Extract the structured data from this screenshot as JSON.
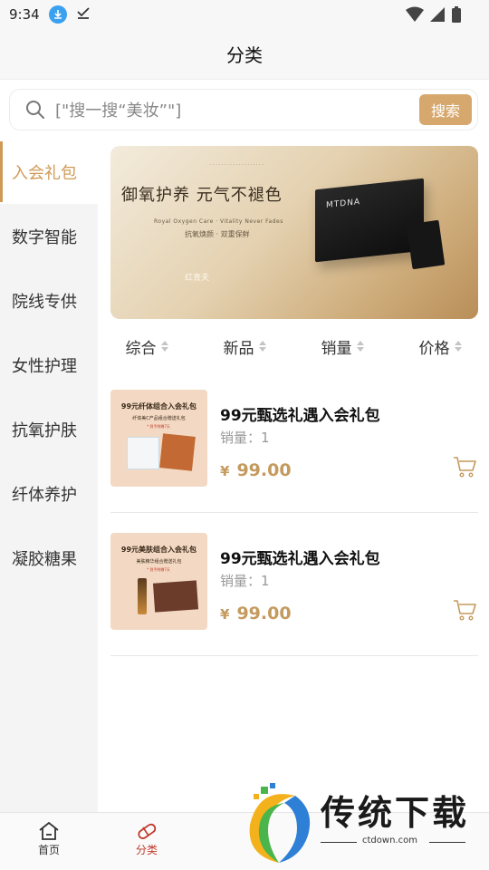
{
  "status": {
    "time": "9:34"
  },
  "title": "分类",
  "search": {
    "placeholder": "[\"搜一搜“美妆”\"]",
    "button": "搜索"
  },
  "sidebar": {
    "items": [
      {
        "label": "入会礼包",
        "active": true
      },
      {
        "label": "数字智能"
      },
      {
        "label": "院线专供"
      },
      {
        "label": "女性护理"
      },
      {
        "label": "抗氧护肤"
      },
      {
        "label": "纤体养护"
      },
      {
        "label": "凝胶糖果"
      }
    ]
  },
  "banner": {
    "headline": "御氧护养 元气不褪色",
    "subline": "Royal Oxygen Care · Vitality Never Fades",
    "tagline": "抗氧焕颜 · 双重保鲜",
    "brand": "红青夫",
    "product_brand": "MTDNA"
  },
  "sort": {
    "options": [
      "综合",
      "新品",
      "销量",
      "价格"
    ]
  },
  "products": [
    {
      "name": "99元甄选礼遇入会礼包",
      "sales": "销量：1",
      "currency": "¥",
      "price": "99.00",
      "thumb_title": "99元纤体组合入会礼包",
      "thumb_sub": "纤体美C产品组合赠送礼包",
      "thumb_tag": "* 到手附赠7天"
    },
    {
      "name": "99元甄选礼遇入会礼包",
      "sales": "销量：1",
      "currency": "¥",
      "price": "99.00",
      "thumb_title": "99元美肤组合入会礼包",
      "thumb_sub": "美肤精华组合赠送礼包",
      "thumb_tag": "* 到手附赠7天"
    }
  ],
  "tabbar": {
    "items": [
      {
        "label": "首页",
        "icon": "home-icon"
      },
      {
        "label": "分类",
        "icon": "category-icon",
        "active": true
      }
    ]
  },
  "watermark": {
    "text": "传统下载",
    "url": "ctdown.com"
  },
  "colors": {
    "accent": "#d09a56",
    "price": "#c49a5e",
    "button": "#d7a86e",
    "tab_active": "#c0392b"
  }
}
